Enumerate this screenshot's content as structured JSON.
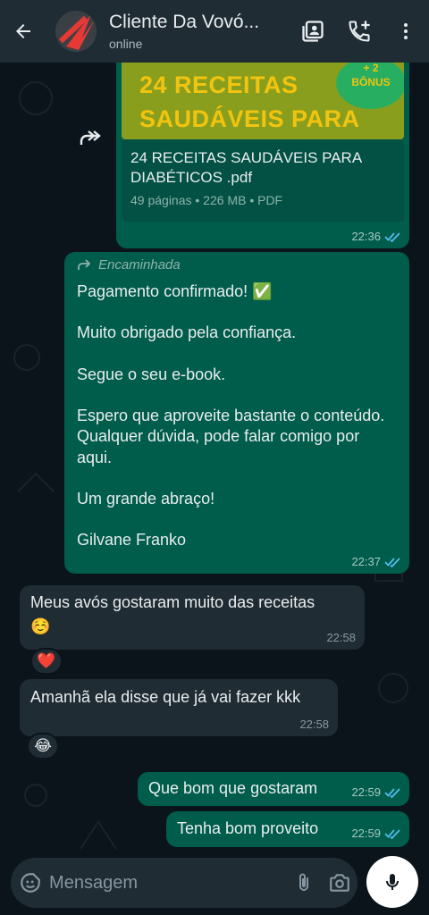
{
  "header": {
    "contact_name": "Cliente Da Vovó...",
    "status": "online",
    "icons": [
      "back-arrow-icon",
      "contact-card-icon",
      "add-call-icon",
      "more-vertical-icon"
    ]
  },
  "file_message": {
    "thumb_line1": "24 RECEITAS",
    "thumb_line2": "SAUDÁVEIS PARA",
    "thumb_badge_top": "+ 2",
    "thumb_badge_bottom": "BÔNUS",
    "file_name": "24 RECEITAS SAUDÁVEIS PARA DIABÉTICOS .pdf",
    "file_meta": "49 páginas • 226 MB • PDF",
    "time": "22:36"
  },
  "forwarded_message": {
    "label": "Encaminhada",
    "text": "Pagamento confirmado! ✅\n\nMuito obrigado pela confiança.\n\nSegue o seu e-book.\n\nEspero que aproveite bastante o conteúdo. Qualquer dúvida, pode falar comigo por aqui.\n\nUm grande abraço!\n\nGilvane Franko",
    "time": "22:37"
  },
  "messages": [
    {
      "text": "Meus avós gostaram muito das receitas\n☺️",
      "time": "22:58",
      "reaction": "❤️"
    },
    {
      "text": "Amanhã ela disse que já vai fazer kkk",
      "time": "22:58",
      "reaction": "😂"
    },
    {
      "text": "Que bom que gostaram",
      "time": "22:59"
    },
    {
      "text": "Tenha bom proveito",
      "time": "22:59"
    }
  ],
  "input": {
    "placeholder": "Mensagem",
    "icons": [
      "emoji-sticker-icon",
      "attach-icon",
      "camera-icon",
      "mic-icon"
    ]
  },
  "colors": {
    "header_bg": "#1f2c34",
    "chat_bg": "#0b141a",
    "outgoing_bubble": "#005c4b",
    "incoming_bubble": "#202c33",
    "read_ticks": "#53bdeb"
  }
}
